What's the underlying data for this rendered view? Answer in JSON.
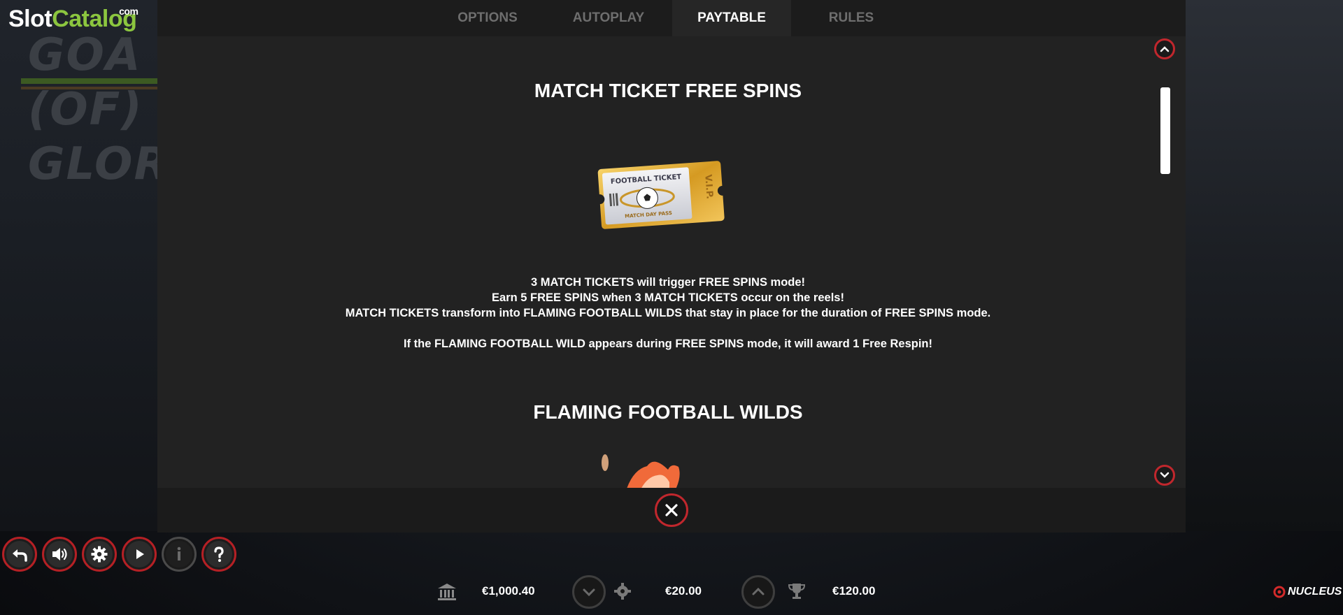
{
  "logo": {
    "slot": "Slot",
    "catalog": "Catalog",
    "com": "com"
  },
  "background": {
    "game_title_art": "GOAL OF GLORY"
  },
  "tabs": [
    {
      "label": "OPTIONS",
      "active": false
    },
    {
      "label": "AUTOPLAY",
      "active": false
    },
    {
      "label": "PAYTABLE",
      "active": true
    },
    {
      "label": "RULES",
      "active": false
    }
  ],
  "paytable": {
    "section1_title": "MATCH TICKET FREE SPINS",
    "ticket": {
      "heading": "FOOTBALL TICKET",
      "subtitle": "MATCH DAY PASS",
      "vip": "V.I.P."
    },
    "lines": [
      "3 MATCH TICKETS will trigger FREE SPINS mode!",
      "Earn 5 FREE SPINS when 3 MATCH TICKETS occur on the reels!",
      "MATCH TICKETS transform into FLAMING FOOTBALL WILDS that stay in place for the duration of FREE SPINS mode."
    ],
    "respin_line": "If the FLAMING FOOTBALL WILD appears during FREE SPINS mode, it will award 1 Free Respin!",
    "section2_title": "FLAMING FOOTBALL WILDS"
  },
  "controls": {
    "back_icon": "back-arrow-icon",
    "sound_icon": "speaker-icon",
    "settings_icon": "gear-icon",
    "autoplay_icon": "play-icon",
    "info_icon": "info-icon",
    "help_icon": "question-icon"
  },
  "status": {
    "balance": "€1,000.40",
    "stake": "€20.00",
    "win": "€120.00"
  },
  "brand": {
    "name": "NUCLEUS"
  },
  "colors": {
    "accent_red": "#c0272d",
    "logo_green": "#8cc63f",
    "panel_bg": "#222222"
  }
}
